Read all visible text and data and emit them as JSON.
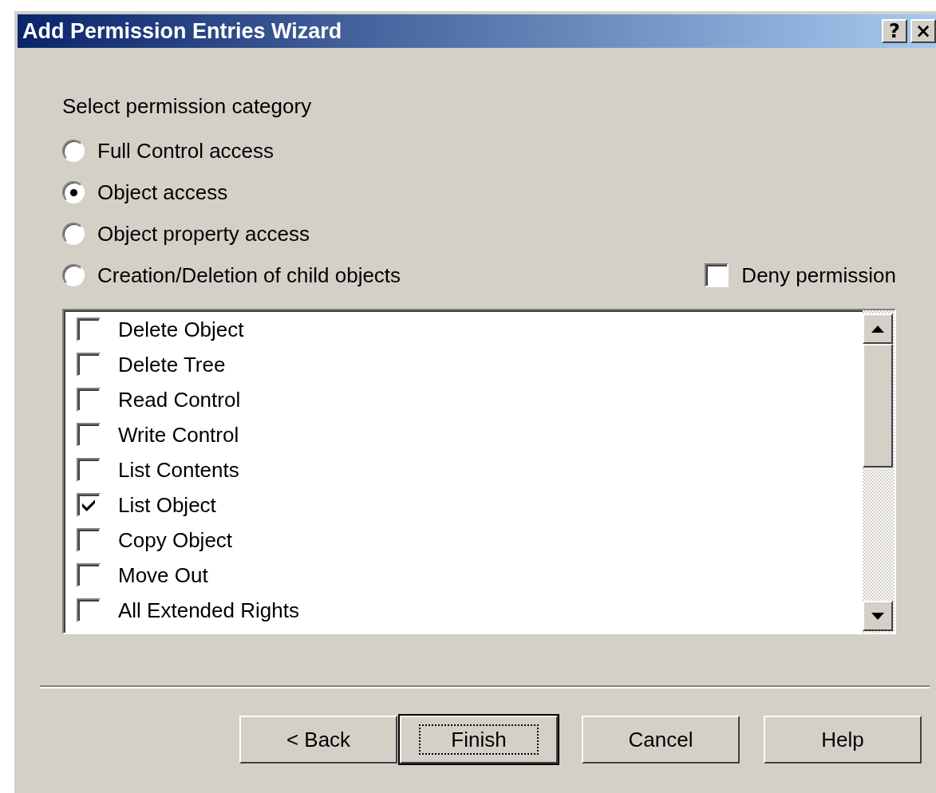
{
  "window": {
    "title": "Add Permission Entries Wizard",
    "title_buttons": [
      {
        "kind": "help",
        "glyph": "?"
      },
      {
        "kind": "close",
        "glyph": "×"
      }
    ]
  },
  "category": {
    "label": "Select permission category",
    "options": [
      {
        "label": "Full Control access",
        "selected": false
      },
      {
        "label": "Object access",
        "selected": true
      },
      {
        "label": "Object property access",
        "selected": false
      },
      {
        "label": "Creation/Deletion of child objects",
        "selected": false
      }
    ]
  },
  "deny": {
    "label": "Deny permission",
    "checked": false
  },
  "permissions": [
    {
      "label": "Delete Object",
      "checked": false
    },
    {
      "label": "Delete Tree",
      "checked": false
    },
    {
      "label": "Read Control",
      "checked": false
    },
    {
      "label": "Write Control",
      "checked": false
    },
    {
      "label": "List Contents",
      "checked": false
    },
    {
      "label": "List Object",
      "checked": true
    },
    {
      "label": "Copy Object",
      "checked": false
    },
    {
      "label": "Move Out",
      "checked": false
    },
    {
      "label": "All Extended Rights",
      "checked": false
    }
  ],
  "buttons": [
    {
      "label": "< Back",
      "default": false
    },
    {
      "label": "Finish",
      "default": true
    },
    {
      "label": "Cancel",
      "default": false
    },
    {
      "label": "Help",
      "default": false
    }
  ]
}
